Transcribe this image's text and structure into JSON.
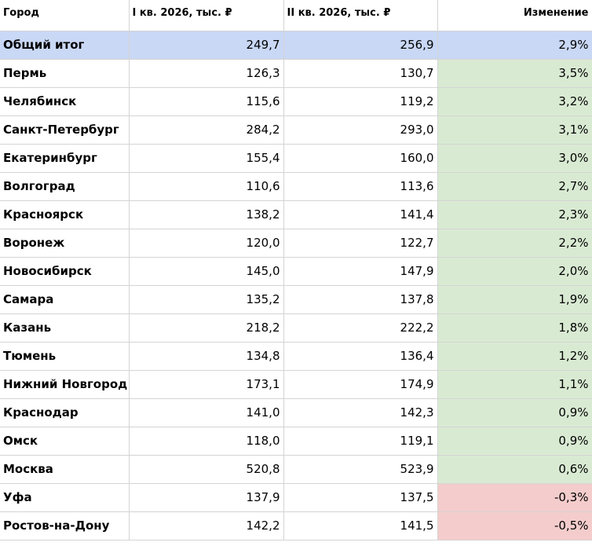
{
  "table": {
    "headers": [
      "Город",
      "I кв. 2026, тыс. ₽",
      "II кв. 2026, тыс. ₽",
      "Изменение"
    ],
    "total": {
      "city": "Общий итог",
      "q1": "249,7",
      "q2": "256,9",
      "change": "2,9%"
    },
    "rows": [
      {
        "city": "Пермь",
        "q1": "126,3",
        "q2": "130,7",
        "change": "3,5%",
        "trend": "positive"
      },
      {
        "city": "Челябинск",
        "q1": "115,6",
        "q2": "119,2",
        "change": "3,2%",
        "trend": "positive"
      },
      {
        "city": "Санкт-Петербург",
        "q1": "284,2",
        "q2": "293,0",
        "change": "3,1%",
        "trend": "positive"
      },
      {
        "city": "Екатеринбург",
        "q1": "155,4",
        "q2": "160,0",
        "change": "3,0%",
        "trend": "positive"
      },
      {
        "city": "Волгоград",
        "q1": "110,6",
        "q2": "113,6",
        "change": "2,7%",
        "trend": "positive"
      },
      {
        "city": "Красноярск",
        "q1": "138,2",
        "q2": "141,4",
        "change": "2,3%",
        "trend": "positive"
      },
      {
        "city": "Воронеж",
        "q1": "120,0",
        "q2": "122,7",
        "change": "2,2%",
        "trend": "positive"
      },
      {
        "city": "Новосибирск",
        "q1": "145,0",
        "q2": "147,9",
        "change": "2,0%",
        "trend": "positive"
      },
      {
        "city": "Самара",
        "q1": "135,2",
        "q2": "137,8",
        "change": "1,9%",
        "trend": "positive"
      },
      {
        "city": "Казань",
        "q1": "218,2",
        "q2": "222,2",
        "change": "1,8%",
        "trend": "positive"
      },
      {
        "city": "Тюмень",
        "q1": "134,8",
        "q2": "136,4",
        "change": "1,2%",
        "trend": "positive"
      },
      {
        "city": "Нижний Новгород",
        "q1": "173,1",
        "q2": "174,9",
        "change": "1,1%",
        "trend": "positive"
      },
      {
        "city": "Краснодар",
        "q1": "141,0",
        "q2": "142,3",
        "change": "0,9%",
        "trend": "positive"
      },
      {
        "city": "Омск",
        "q1": "118,0",
        "q2": "119,1",
        "change": "0,9%",
        "trend": "positive"
      },
      {
        "city": "Москва",
        "q1": "520,8",
        "q2": "523,9",
        "change": "0,6%",
        "trend": "positive"
      },
      {
        "city": "Уфа",
        "q1": "137,9",
        "q2": "137,5",
        "change": "-0,3%",
        "trend": "negative"
      },
      {
        "city": "Ростов-на-Дону",
        "q1": "142,2",
        "q2": "141,5",
        "change": "-0,5%",
        "trend": "negative"
      }
    ]
  },
  "colors": {
    "total_row": "#c9d8f5",
    "positive": "#d9ead3",
    "negative": "#f4cccc",
    "grid": "#d4d4d4"
  }
}
